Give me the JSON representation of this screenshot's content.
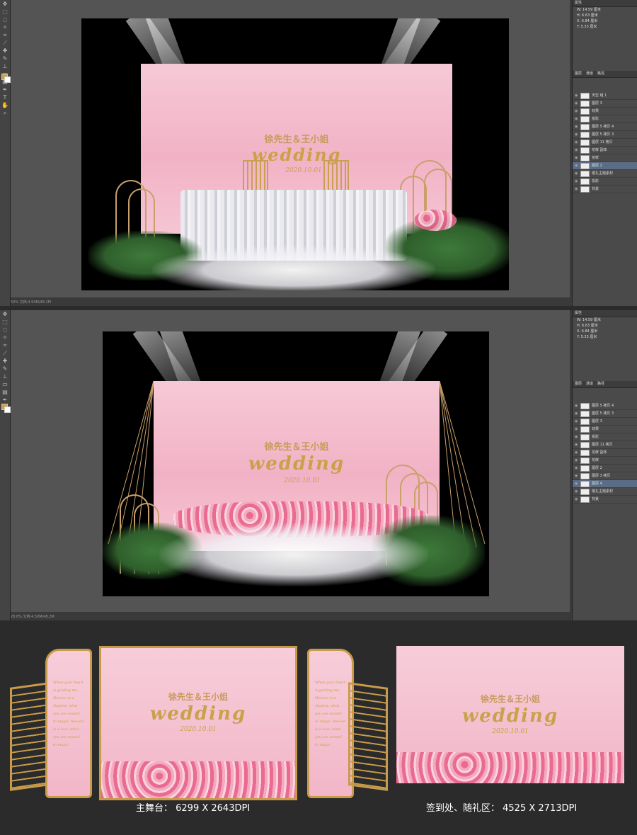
{
  "window1": {
    "status_text": "50%   文档:4.50M/48.2M",
    "properties": [
      "W: 14.59 厘米",
      "H: 6.63 厘米",
      "X: 6.84 厘米",
      "Y: 5.33 厘米"
    ],
    "panel_tabs": [
      "图层",
      "通道",
      "路径"
    ],
    "layers": [
      "天空 组 1",
      "图层 3",
      "效果",
      "投影",
      "图层 5 拷贝 4",
      "图层 5 拷贝 3",
      "图层 11 拷贝",
      "花鲜 副本",
      "花鲜",
      "图层 2",
      "婚礼主题素材",
      "投影",
      "背景"
    ],
    "selected_layer_index": 9
  },
  "window2": {
    "status_text": "28.6%   文档:4.50M/48.2M",
    "properties": [
      "W: 14.59 厘米",
      "H: 6.63 厘米",
      "X: 6.84 厘米",
      "Y: 5.33 厘米"
    ],
    "panel_tabs": [
      "图层",
      "通道",
      "路径"
    ],
    "layers": [
      "图层 5 拷贝 4",
      "图层 5 拷贝 3",
      "图层 3",
      "效果",
      "投影",
      "图层 11 拷贝",
      "花鲜 副本",
      "花鲜",
      "图层 2",
      "图层 3 拷贝",
      "图层 4",
      "婚礼主题素材",
      "背景"
    ],
    "selected_layer_index": 10
  },
  "artwork": {
    "names": "徐先生＆王小姐",
    "wedding": "wedding",
    "date": "2020.10.01",
    "poem": "When your heart is guiding me, Heaven is a shadow, what you see wound to magic, heaven is a love, what you see wound to magic"
  },
  "captions": {
    "stage": "主舞台： 6299 X 2643DPI",
    "signin": "签到处、随礼区： 4525 X 2713DPI"
  },
  "colors": {
    "gold": "#c9a14a",
    "pink": "#f2b2c6",
    "ps_bg": "#3a3a3a"
  }
}
